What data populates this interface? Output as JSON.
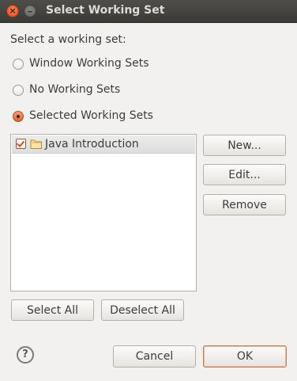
{
  "window": {
    "title": "Select Working Set",
    "close_glyph": "×",
    "minimize_glyph": "–"
  },
  "prompt": "Select a working set:",
  "radios": [
    {
      "label": "Window Working Sets",
      "checked": false
    },
    {
      "label": "No Working Sets",
      "checked": false
    },
    {
      "label": "Selected Working Sets",
      "checked": true
    }
  ],
  "list": {
    "items": [
      {
        "label": "Java Introduction",
        "checked": true,
        "icon": "folder-icon"
      }
    ]
  },
  "side_buttons": {
    "new": "New...",
    "edit": "Edit...",
    "remove": "Remove"
  },
  "bottom_buttons": {
    "select_all": "Select All",
    "deselect_all": "Deselect All"
  },
  "footer": {
    "help_glyph": "?",
    "cancel": "Cancel",
    "ok": "OK"
  },
  "colors": {
    "accent": "#e0602e",
    "titlebar": "#3c3b37",
    "background": "#f2f1f0"
  }
}
